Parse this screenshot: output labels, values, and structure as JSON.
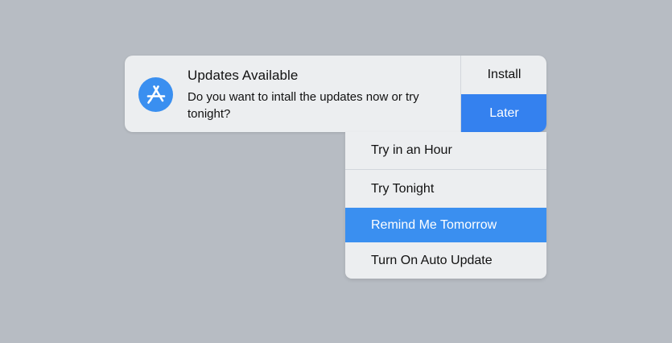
{
  "notification": {
    "app_icon": "app-store-icon",
    "title": "Updates Available",
    "message": "Do you want to intall the updates now or try tonight?",
    "actions": {
      "install_label": "Install",
      "later_label": "Later"
    }
  },
  "later_menu": {
    "items": [
      {
        "label": "Try in an Hour"
      },
      {
        "label": "Try Tonight"
      },
      {
        "label": "Remind Me Tomorrow",
        "highlighted": true
      },
      {
        "label": "Turn On Auto Update"
      }
    ]
  },
  "colors": {
    "background": "#b7bcc3",
    "panel": "#eceef0",
    "accent": "#3481ef",
    "highlight": "#3a8ff0"
  }
}
